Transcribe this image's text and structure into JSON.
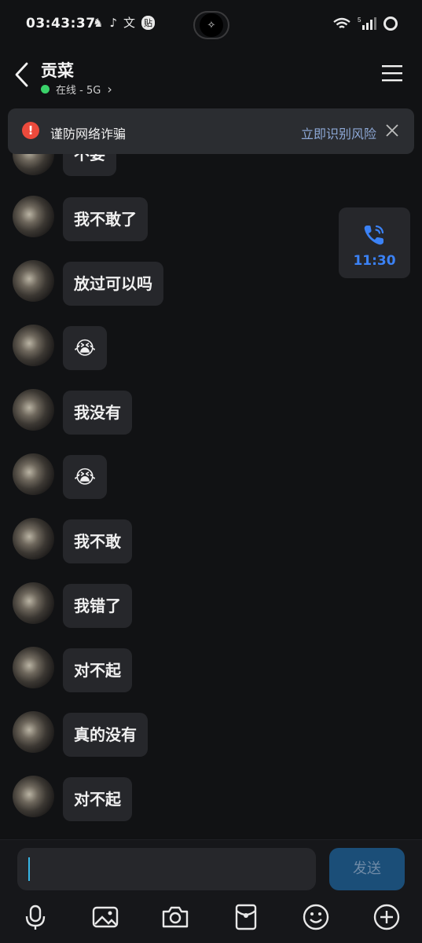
{
  "status_bar": {
    "time": "03:43:37",
    "icons": [
      "qq-icon",
      "tiktok-icon",
      "translate-icon",
      "sticker-icon"
    ],
    "icon_glyphs": [
      "♞",
      "♪",
      "文",
      "贴"
    ],
    "island_glyph": "✧",
    "signal_prefix": "5"
  },
  "header": {
    "contact_name": "贡菜",
    "status_text": "在线 - 5G",
    "status_color": "#3ad26a",
    "chevron": "›"
  },
  "banner": {
    "warning_glyph": "!",
    "text": "谨防网络诈骗",
    "action": "立即识别风险"
  },
  "messages": [
    {
      "text": "不要",
      "partial": true
    },
    {
      "text": "我不敢了"
    },
    {
      "text": "放过可以吗"
    },
    {
      "text": "😭",
      "emoji": true
    },
    {
      "text": "我没有"
    },
    {
      "text": "😭",
      "emoji": true
    },
    {
      "text": "我不敢"
    },
    {
      "text": "我错了"
    },
    {
      "text": "对不起"
    },
    {
      "text": "真的没有"
    },
    {
      "text": "对不起"
    }
  ],
  "call_card": {
    "duration": "11:30",
    "color": "#3b82f6"
  },
  "composer": {
    "input_value": "",
    "send_label": "发送"
  },
  "toolbar": [
    "microphone-icon",
    "image-icon",
    "camera-icon",
    "red-packet-icon",
    "emoji-icon",
    "add-icon"
  ]
}
